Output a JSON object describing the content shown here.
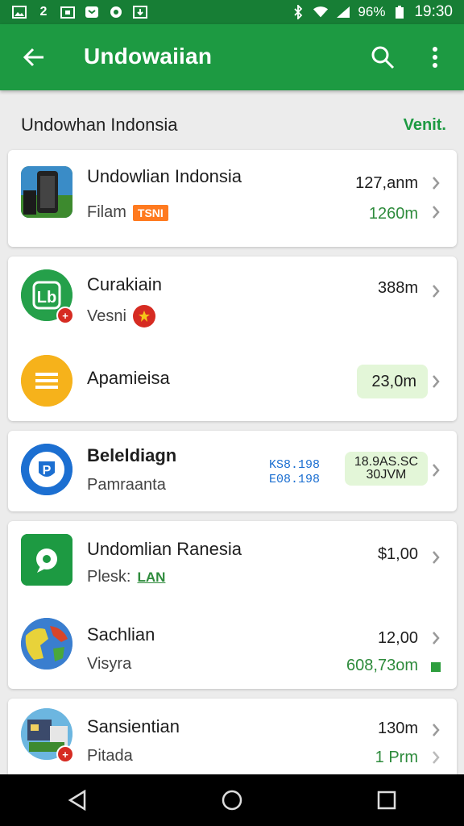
{
  "statusbar": {
    "battery": "96%",
    "time": "19:30"
  },
  "appbar": {
    "title": "Undowaiian"
  },
  "section": {
    "title": "Undowhan Indonsia",
    "link": "Venit."
  },
  "cards": [
    {
      "rows": [
        {
          "name": "Undowlian Indonsia",
          "sub": "Filam",
          "tag": "TSNI",
          "value": "127,anm",
          "value2": "1260m"
        }
      ]
    },
    {
      "rows": [
        {
          "name": "Curakiain",
          "sub": "Vesni",
          "value": "388m"
        },
        {
          "name": "Apamieisa",
          "value": "23,0m"
        }
      ]
    },
    {
      "rows": [
        {
          "name": "Beleldiagn",
          "sub": "Pamraanta",
          "code1": "KS8.198",
          "code2": "E08.198",
          "pill_top": "18.9AS.SC",
          "pill_bottom": "30JVM"
        }
      ]
    },
    {
      "rows": [
        {
          "name": "Undomlian Ranesia",
          "sub": "Plesk:",
          "tag": "LAN",
          "value": "$1,00"
        },
        {
          "name": "Sachlian",
          "sub": "Visyra",
          "value": "12,00",
          "value2": "608,73om"
        }
      ]
    },
    {
      "rows": [
        {
          "name": "Sansientian",
          "sub": "Pitada",
          "value": "130m",
          "value2": "1 Prm"
        }
      ]
    }
  ]
}
